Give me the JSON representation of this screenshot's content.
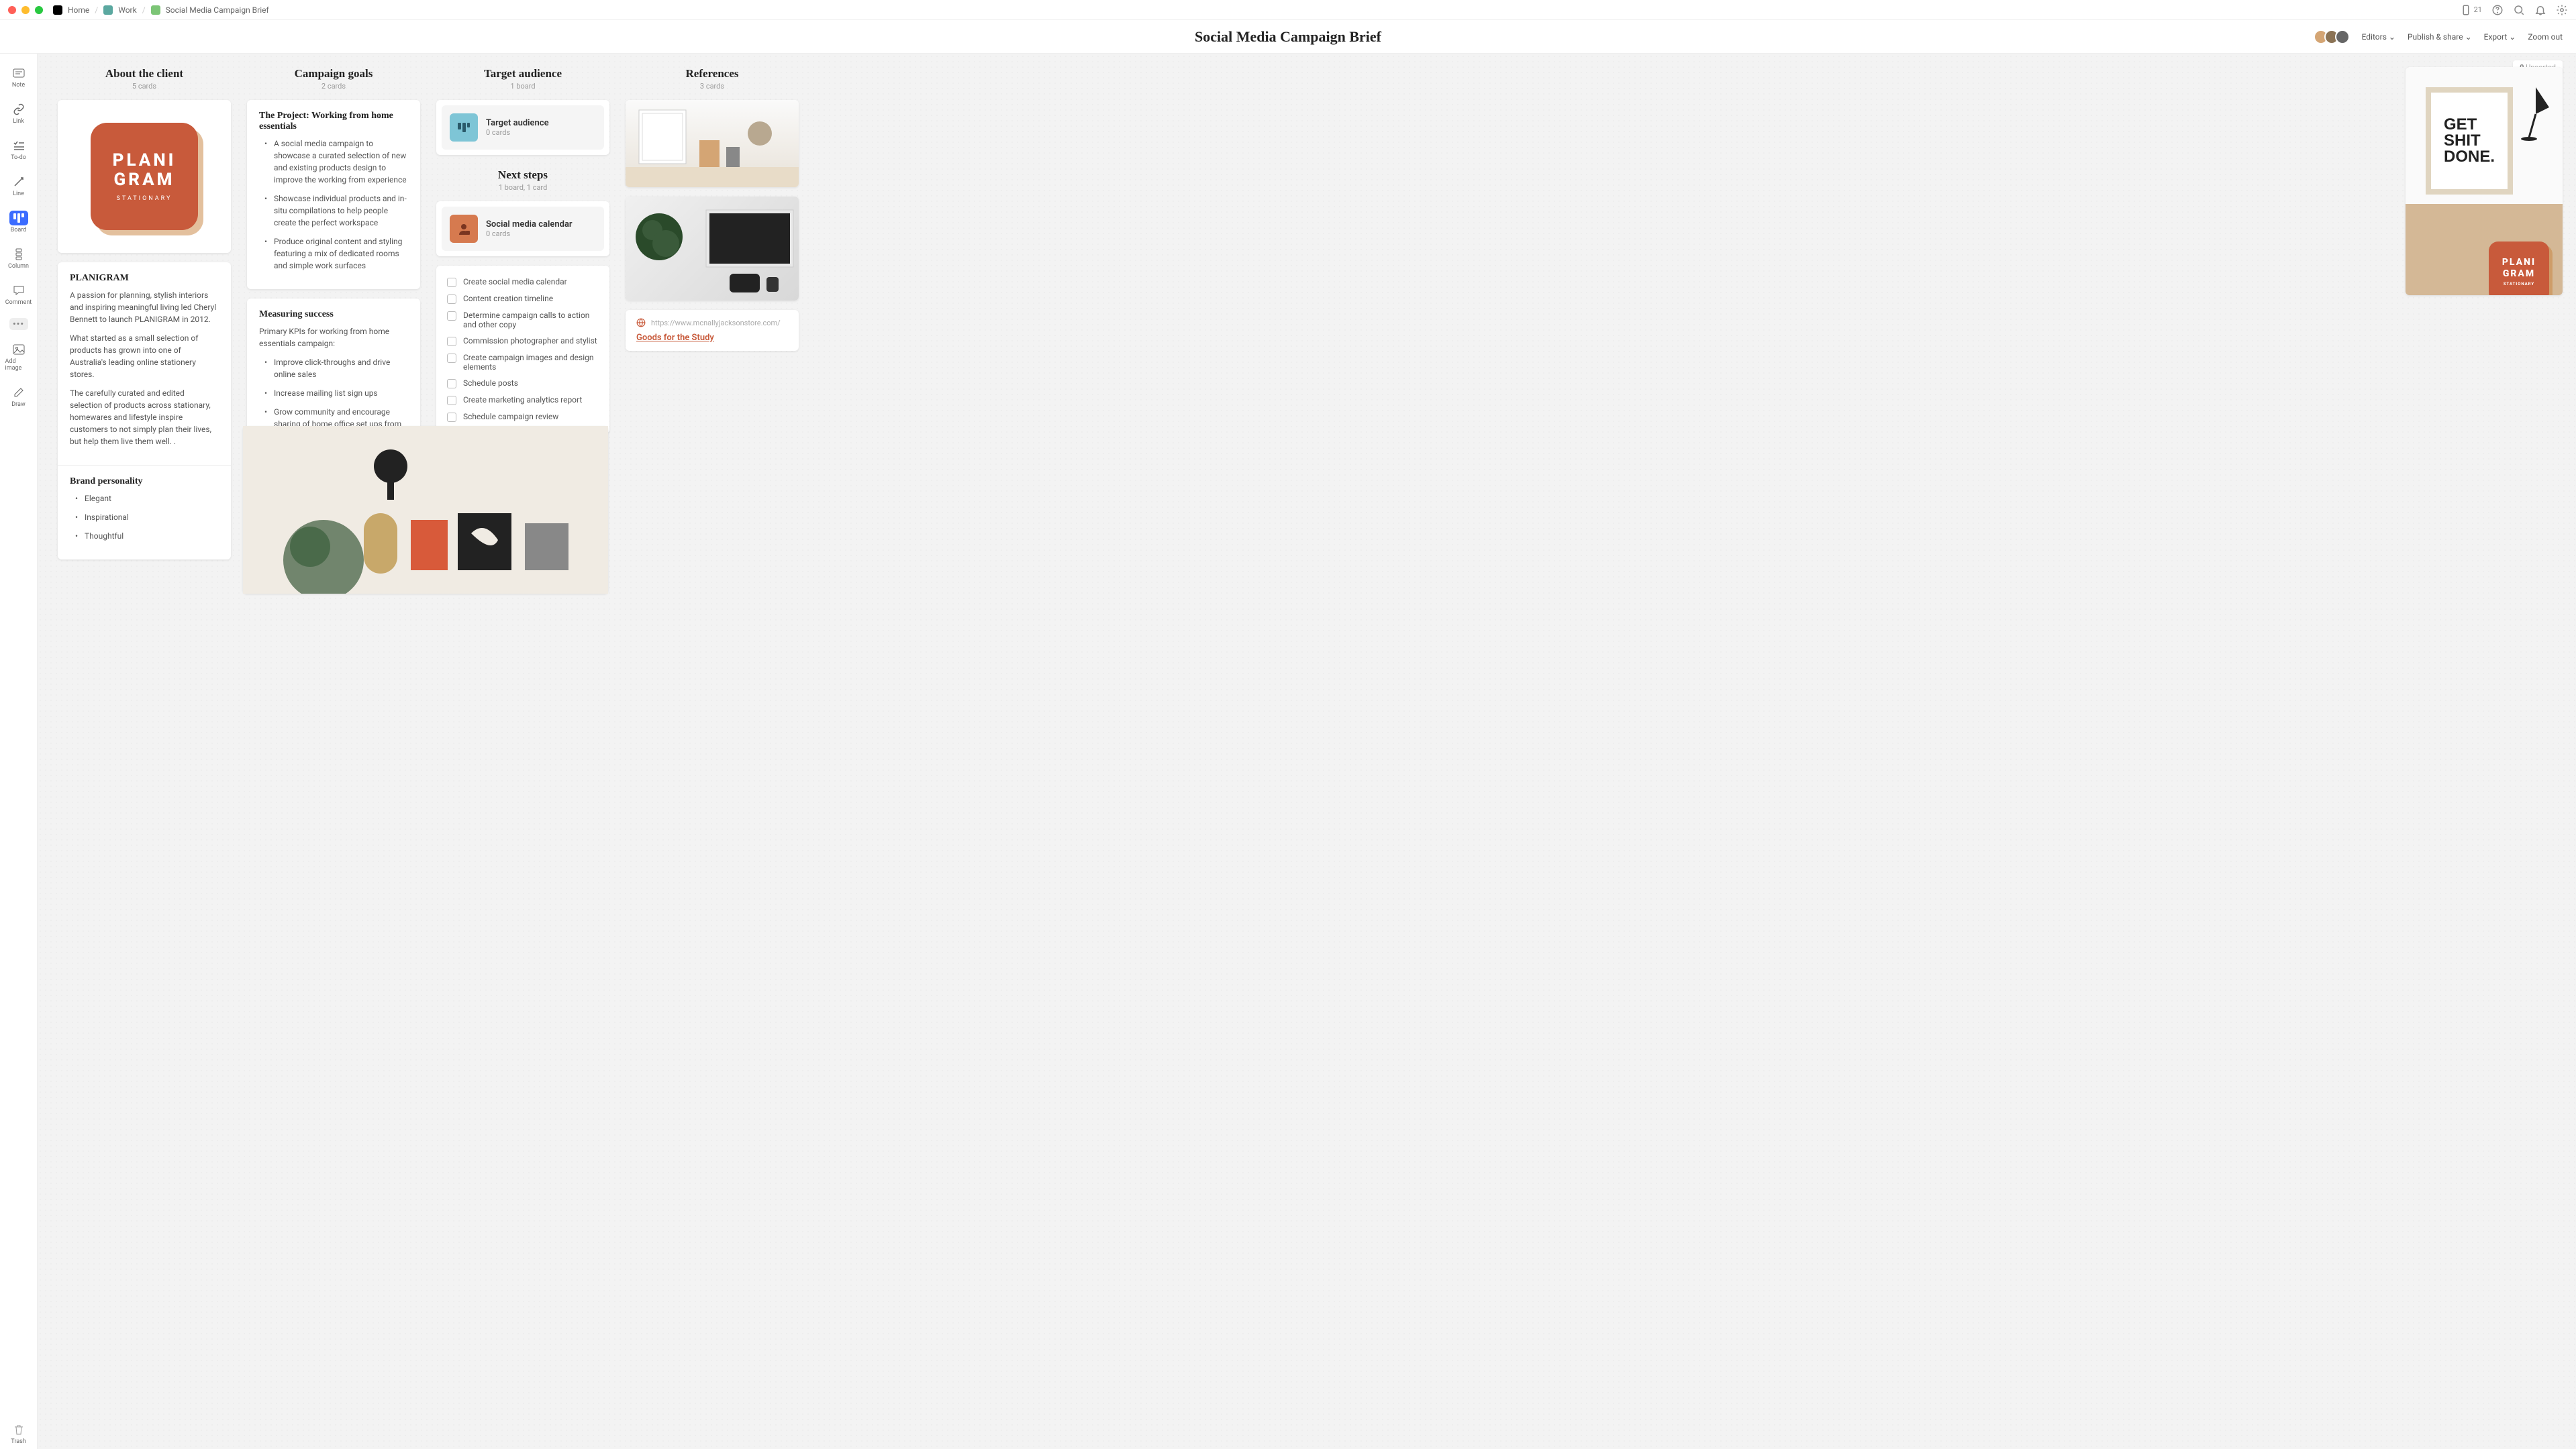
{
  "breadcrumbs": {
    "home": "Home",
    "work": "Work",
    "doc": "Social Media Campaign Brief"
  },
  "titlebar": {
    "device_count": "21"
  },
  "header": {
    "title": "Social Media Campaign Brief",
    "editors": "Editors",
    "publish": "Publish & share",
    "export": "Export",
    "zoom": "Zoom out"
  },
  "unsorted": {
    "count": "0",
    "label": "Unsorted"
  },
  "sidebar": {
    "note": "Note",
    "link": "Link",
    "todo": "To-do",
    "line": "Line",
    "board": "Board",
    "column": "Column",
    "comment": "Comment",
    "add_image": "Add image",
    "draw": "Draw",
    "trash": "Trash"
  },
  "columns": {
    "about": {
      "title": "About the client",
      "meta": "5 cards"
    },
    "goals": {
      "title": "Campaign goals",
      "meta": "2 cards"
    },
    "audience": {
      "title": "Target audience",
      "meta": "1 board"
    },
    "next": {
      "title": "Next steps",
      "meta": "1 board, 1 card"
    },
    "refs": {
      "title": "References",
      "meta": "3 cards"
    }
  },
  "logo": {
    "line1": "PLANI",
    "line2": "GRAM",
    "sub": "STATIONARY"
  },
  "about": {
    "heading": "PLANIGRAM",
    "p1": "A passion for planning, stylish interiors and inspiring meaningful living led Cheryl Bennett to launch PLANIGRAM in 2012.",
    "p2": "What started as a small selection of products has grown into one of Australia's leading online stationery stores.",
    "p3": "The carefully curated and edited selection of products across stationary, homewares and lifestyle inspire customers to not simply plan their lives, but help them live them well. .",
    "brand_title": "Brand personality",
    "brand": [
      "Elegant",
      "Inspirational",
      "Thoughtful"
    ]
  },
  "goals": {
    "project_title": "The Project: Working from home essentials",
    "project_bullets": [
      "A social media campaign to showcase a curated selection of new and existing products design to improve the working from experience",
      "Showcase individual products and in-situ compilations to help people create the perfect workspace",
      "Produce original content and styling featuring a mix of dedicated rooms and simple work surfaces"
    ],
    "measure_title": "Measuring success",
    "measure_intro": "Primary KPIs for working from home essentials campaign:",
    "measure_bullets": [
      "Improve click-throughs and drive online sales",
      "Increase mailing list sign ups",
      "Grow community and encourage sharing of home office set ups from customers"
    ]
  },
  "audience_board": {
    "title": "Target audience",
    "meta": "0 cards"
  },
  "calendar_board": {
    "title": "Social media calendar",
    "meta": "0 cards"
  },
  "todos": [
    "Create social media calendar",
    "Content creation timeline",
    "Determine campaign calls to action and other copy",
    "Commission photographer and stylist",
    "Create campaign images and design elements",
    "Schedule posts",
    "Create marketing analytics report",
    "Schedule campaign review"
  ],
  "refs": {
    "url": "https://www.mcnallyjacksonstore.com/",
    "link_title": "Goods for the Study"
  },
  "poster": "GET\nSHIT\nDONE."
}
